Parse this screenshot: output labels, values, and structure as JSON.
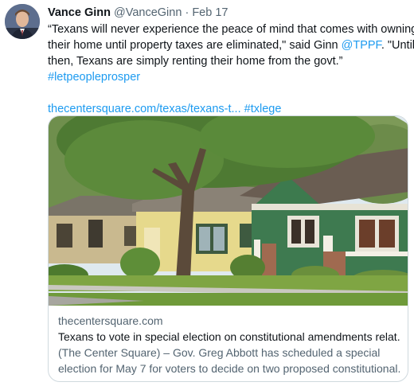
{
  "author": {
    "name": "Vance Ginn",
    "handle": "@VanceGinn",
    "separator": "·",
    "date": "Feb 17"
  },
  "tweet": {
    "line1": "“Texans will never experience the peace of mind that comes with owning",
    "line2_pre": "their home until property taxes are eliminated,\" said Ginn ",
    "mention": "@TPPF",
    "line2_post": ". \"Until",
    "line3": "then, Texans are simply renting their home from the govt.”",
    "hashtag1": "#letpeopleprosper",
    "url": "thecentersquare.com/texas/texans-t...",
    "hashtag2": "#txlege"
  },
  "card": {
    "domain": "thecentersquare.com",
    "title": "Texans to vote in special election on constitutional amendments relat...",
    "desc_line1": "(The Center Square) – Gov. Greg Abbott has scheduled a special",
    "desc_line2": "election for May 7 for voters to decide on two proposed constitutional..."
  },
  "colors": {
    "link": "#1d9bf0",
    "secondary_text": "#536471",
    "border": "#cfd9de"
  }
}
